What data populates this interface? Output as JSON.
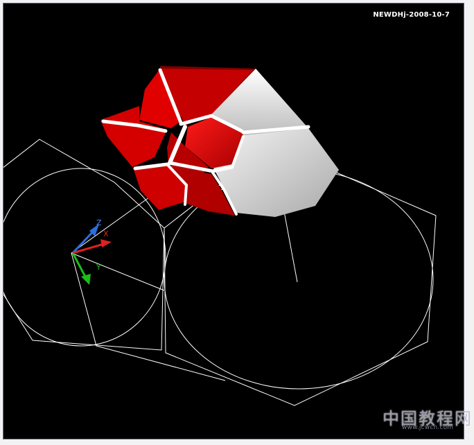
{
  "viewport": {
    "stamp_text": "NEWDHj-2008-10-7",
    "background": "#000000",
    "wire_color": "#ffffff"
  },
  "ucs_icon": {
    "x_label": "X",
    "y_label": "Y",
    "z_label": "Z",
    "x_color": "#e02020",
    "y_color": "#19c019",
    "z_color": "#2a6fe0"
  },
  "model": {
    "red_color": "#d40000",
    "gray_color": "#d9d9d9"
  },
  "watermark": {
    "site_name": "中国教程网",
    "url": "www.jcwcn.com"
  }
}
